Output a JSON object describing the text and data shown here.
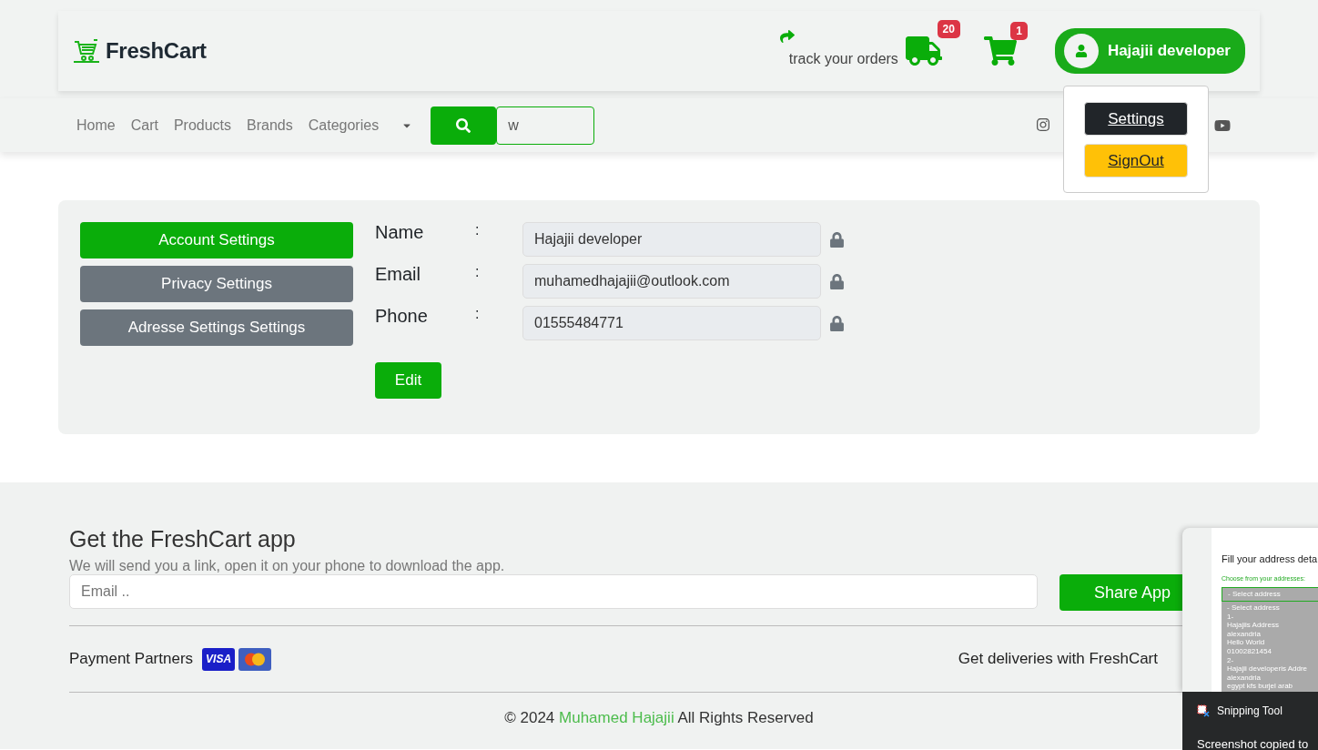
{
  "header": {
    "logo": "FreshCart",
    "track": {
      "label": "track your orders",
      "badge": "20"
    },
    "cart": {
      "badge": "1"
    },
    "user": {
      "name": "Hajajii developer"
    }
  },
  "user_menu": [
    {
      "label": "Settings",
      "kind": "dark"
    },
    {
      "label": "SignOut",
      "kind": "warning"
    }
  ],
  "nav": {
    "links": [
      "Home",
      "Cart",
      "Products",
      "Brands",
      "Categories"
    ],
    "search": {
      "value": "w"
    }
  },
  "settings": {
    "tabs": [
      {
        "label": "Account Settings",
        "selected": true
      },
      {
        "label": "Privacy Settings",
        "selected": false
      },
      {
        "label": "Adresse Settings Settings",
        "selected": false
      }
    ],
    "fields": [
      {
        "label": "Name",
        "separator": ":",
        "value": "Hajajii developer",
        "locked": true
      },
      {
        "label": "Email",
        "separator": ":",
        "value": "muhamedhajajii@outlook.com",
        "locked": true
      },
      {
        "label": "Phone",
        "separator": ":",
        "value": "01555484771",
        "locked": true
      }
    ],
    "edit_button": "Edit"
  },
  "footer": {
    "title": "Get the FreshCart app",
    "subtitle": "We will send you a link, open it on your phone to download the app.",
    "email_placeholder": "Email ..",
    "share_button": "Share App",
    "payment_label": "Payment Partners",
    "payment_cards": [
      {
        "kind": "visa",
        "label": "VISA"
      },
      {
        "kind": "mastercard"
      }
    ],
    "deliveries_label": "Get deliveries with FreshCart",
    "copyright": {
      "prefix": "© 2024",
      "author": "Muhamed Hajajii",
      "suffix": "All Rights Reserved"
    }
  },
  "snip": {
    "thumbnail": {
      "title": "Fill your address deta",
      "prompt": "Choose from your addresses:",
      "select": "- Select address",
      "options": [
        "- Select address",
        "1-",
        "Hajajiis Address",
        "alexandria",
        "Hello World",
        "01002821454",
        "2-",
        "Hajajii developeris Addre",
        "alexandria",
        "egypt kfs burjel arab"
      ]
    },
    "app": "Snipping Tool",
    "message": "Screenshot copied to"
  }
}
